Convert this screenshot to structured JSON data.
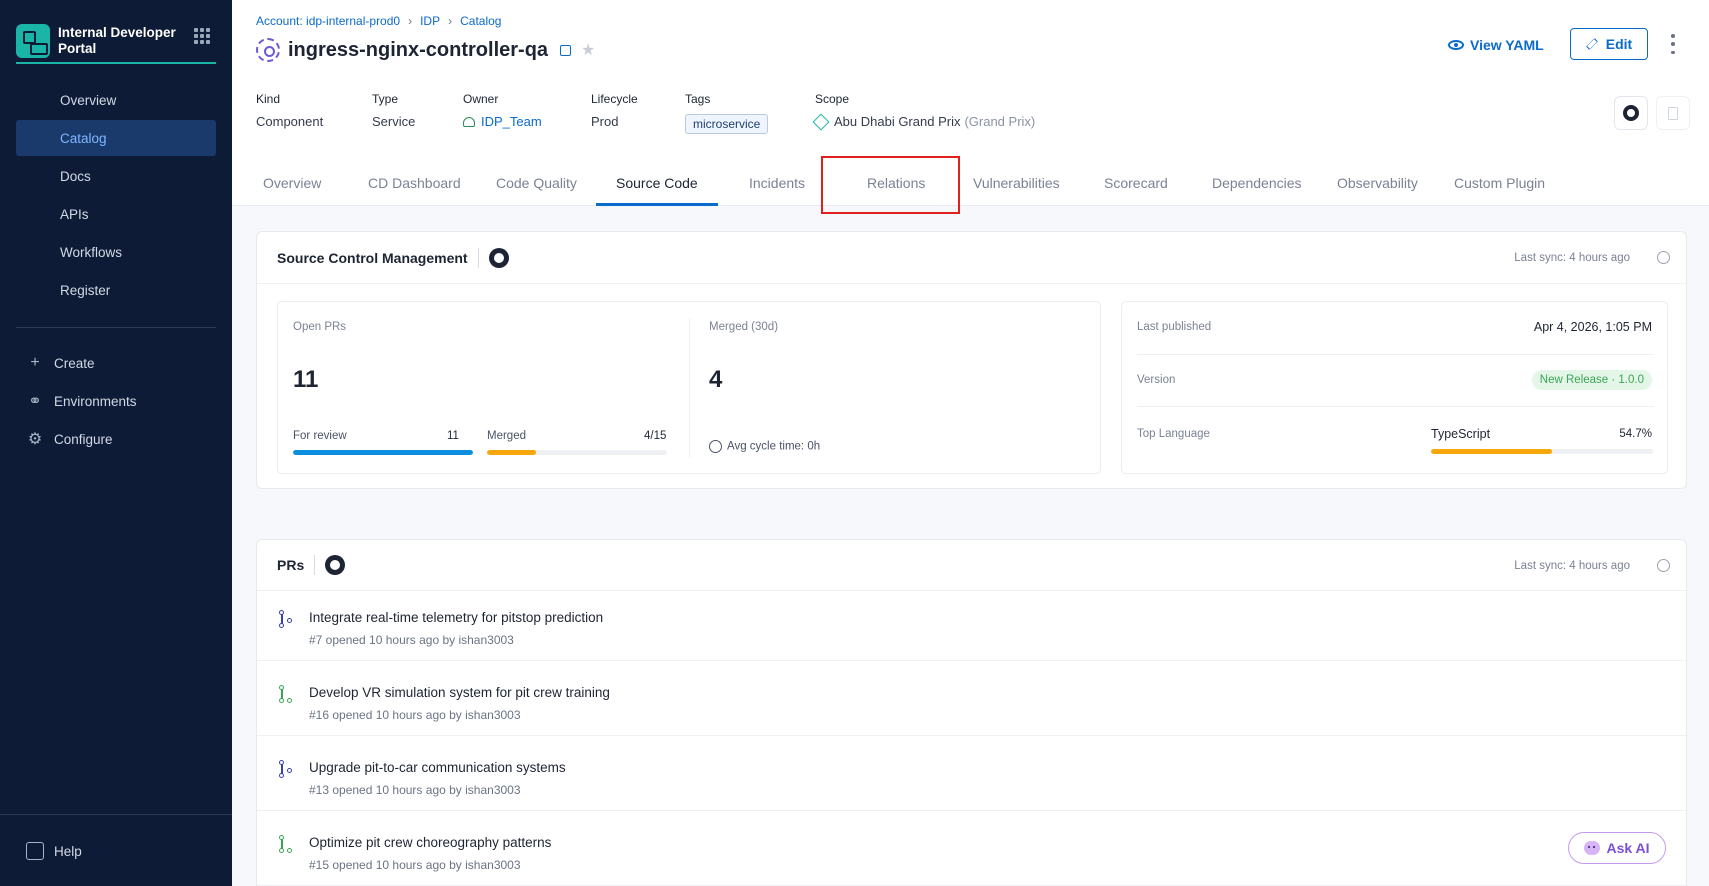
{
  "sidebar": {
    "brand": "Internal Developer Portal",
    "items": [
      {
        "label": "Overview"
      },
      {
        "label": "Catalog"
      },
      {
        "label": "Docs"
      },
      {
        "label": "APIs"
      },
      {
        "label": "Workflows"
      },
      {
        "label": "Register"
      }
    ],
    "secondary": [
      {
        "label": "Create",
        "icon": "plus-icon"
      },
      {
        "label": "Environments",
        "icon": "environments-icon"
      },
      {
        "label": "Configure",
        "icon": "gear-icon"
      }
    ],
    "help": "Help",
    "active_color": "#1a3a6b",
    "accent": "#19b5a6"
  },
  "breadcrumb": {
    "account": "Account: idp-internal-prod0",
    "idp": "IDP",
    "catalog": "Catalog"
  },
  "entity": {
    "title": "ingress-nginx-controller-qa",
    "view_yaml": "View YAML",
    "edit": "Edit",
    "kind_label": "Kind",
    "kind": "Component",
    "type_label": "Type",
    "type": "Service",
    "owner_label": "Owner",
    "owner": "IDP_Team",
    "lifecycle_label": "Lifecycle",
    "lifecycle": "Prod",
    "tags_label": "Tags",
    "tag": "microservice",
    "scope_label": "Scope",
    "scope": "Abu Dhabi Grand Prix",
    "scope_suffix": "(Grand Prix)"
  },
  "tabs": [
    {
      "label": "Overview"
    },
    {
      "label": "CD Dashboard"
    },
    {
      "label": "Code Quality"
    },
    {
      "label": "Source Code",
      "active": true
    },
    {
      "label": "Incidents"
    },
    {
      "label": "Relations"
    },
    {
      "label": "Vulnerabilities"
    },
    {
      "label": "Scorecard"
    },
    {
      "label": "Dependencies"
    },
    {
      "label": "Observability"
    },
    {
      "label": "Custom Plugin"
    }
  ],
  "scm": {
    "title": "Source Control Management",
    "sync": "Last sync: 4 hours ago",
    "open_prs_label": "Open PRs",
    "open_prs": "11",
    "for_review_label": "For review",
    "for_review": "11",
    "for_review_fraction": 1.0,
    "merged_bar_label": "Merged",
    "merged_bar_value": "4/15",
    "merged_fraction": 0.27,
    "merged30_label": "Merged (30d)",
    "merged30": "4",
    "avg_cycle": "Avg cycle time: 0h",
    "last_published_label": "Last published",
    "last_published": "Apr 4, 2026, 1:05 PM",
    "version_label": "Version",
    "version": "New Release · 1.0.0",
    "top_language_label": "Top Language",
    "top_language": "TypeScript",
    "top_language_pct": "54.7%",
    "top_language_fraction": 0.547,
    "colors": {
      "blue": "#0b8ee0",
      "orange": "#f5a70c"
    }
  },
  "prs": {
    "title": "PRs",
    "sync": "Last sync: 4 hours ago",
    "items": [
      {
        "title": "Integrate real-time telemetry for pitstop prediction",
        "sub": "#7 opened 10 hours ago by ishan3003",
        "state": "merged"
      },
      {
        "title": "Develop VR simulation system for pit crew training",
        "sub": "#16 opened 10 hours ago by ishan3003",
        "state": "open"
      },
      {
        "title": "Upgrade pit-to-car communication systems",
        "sub": "#13 opened 10 hours ago by ishan3003",
        "state": "merged"
      },
      {
        "title": "Optimize pit crew choreography patterns",
        "sub": "#15 opened 10 hours ago by ishan3003",
        "state": "open"
      }
    ]
  },
  "ask_ai": "Ask AI"
}
